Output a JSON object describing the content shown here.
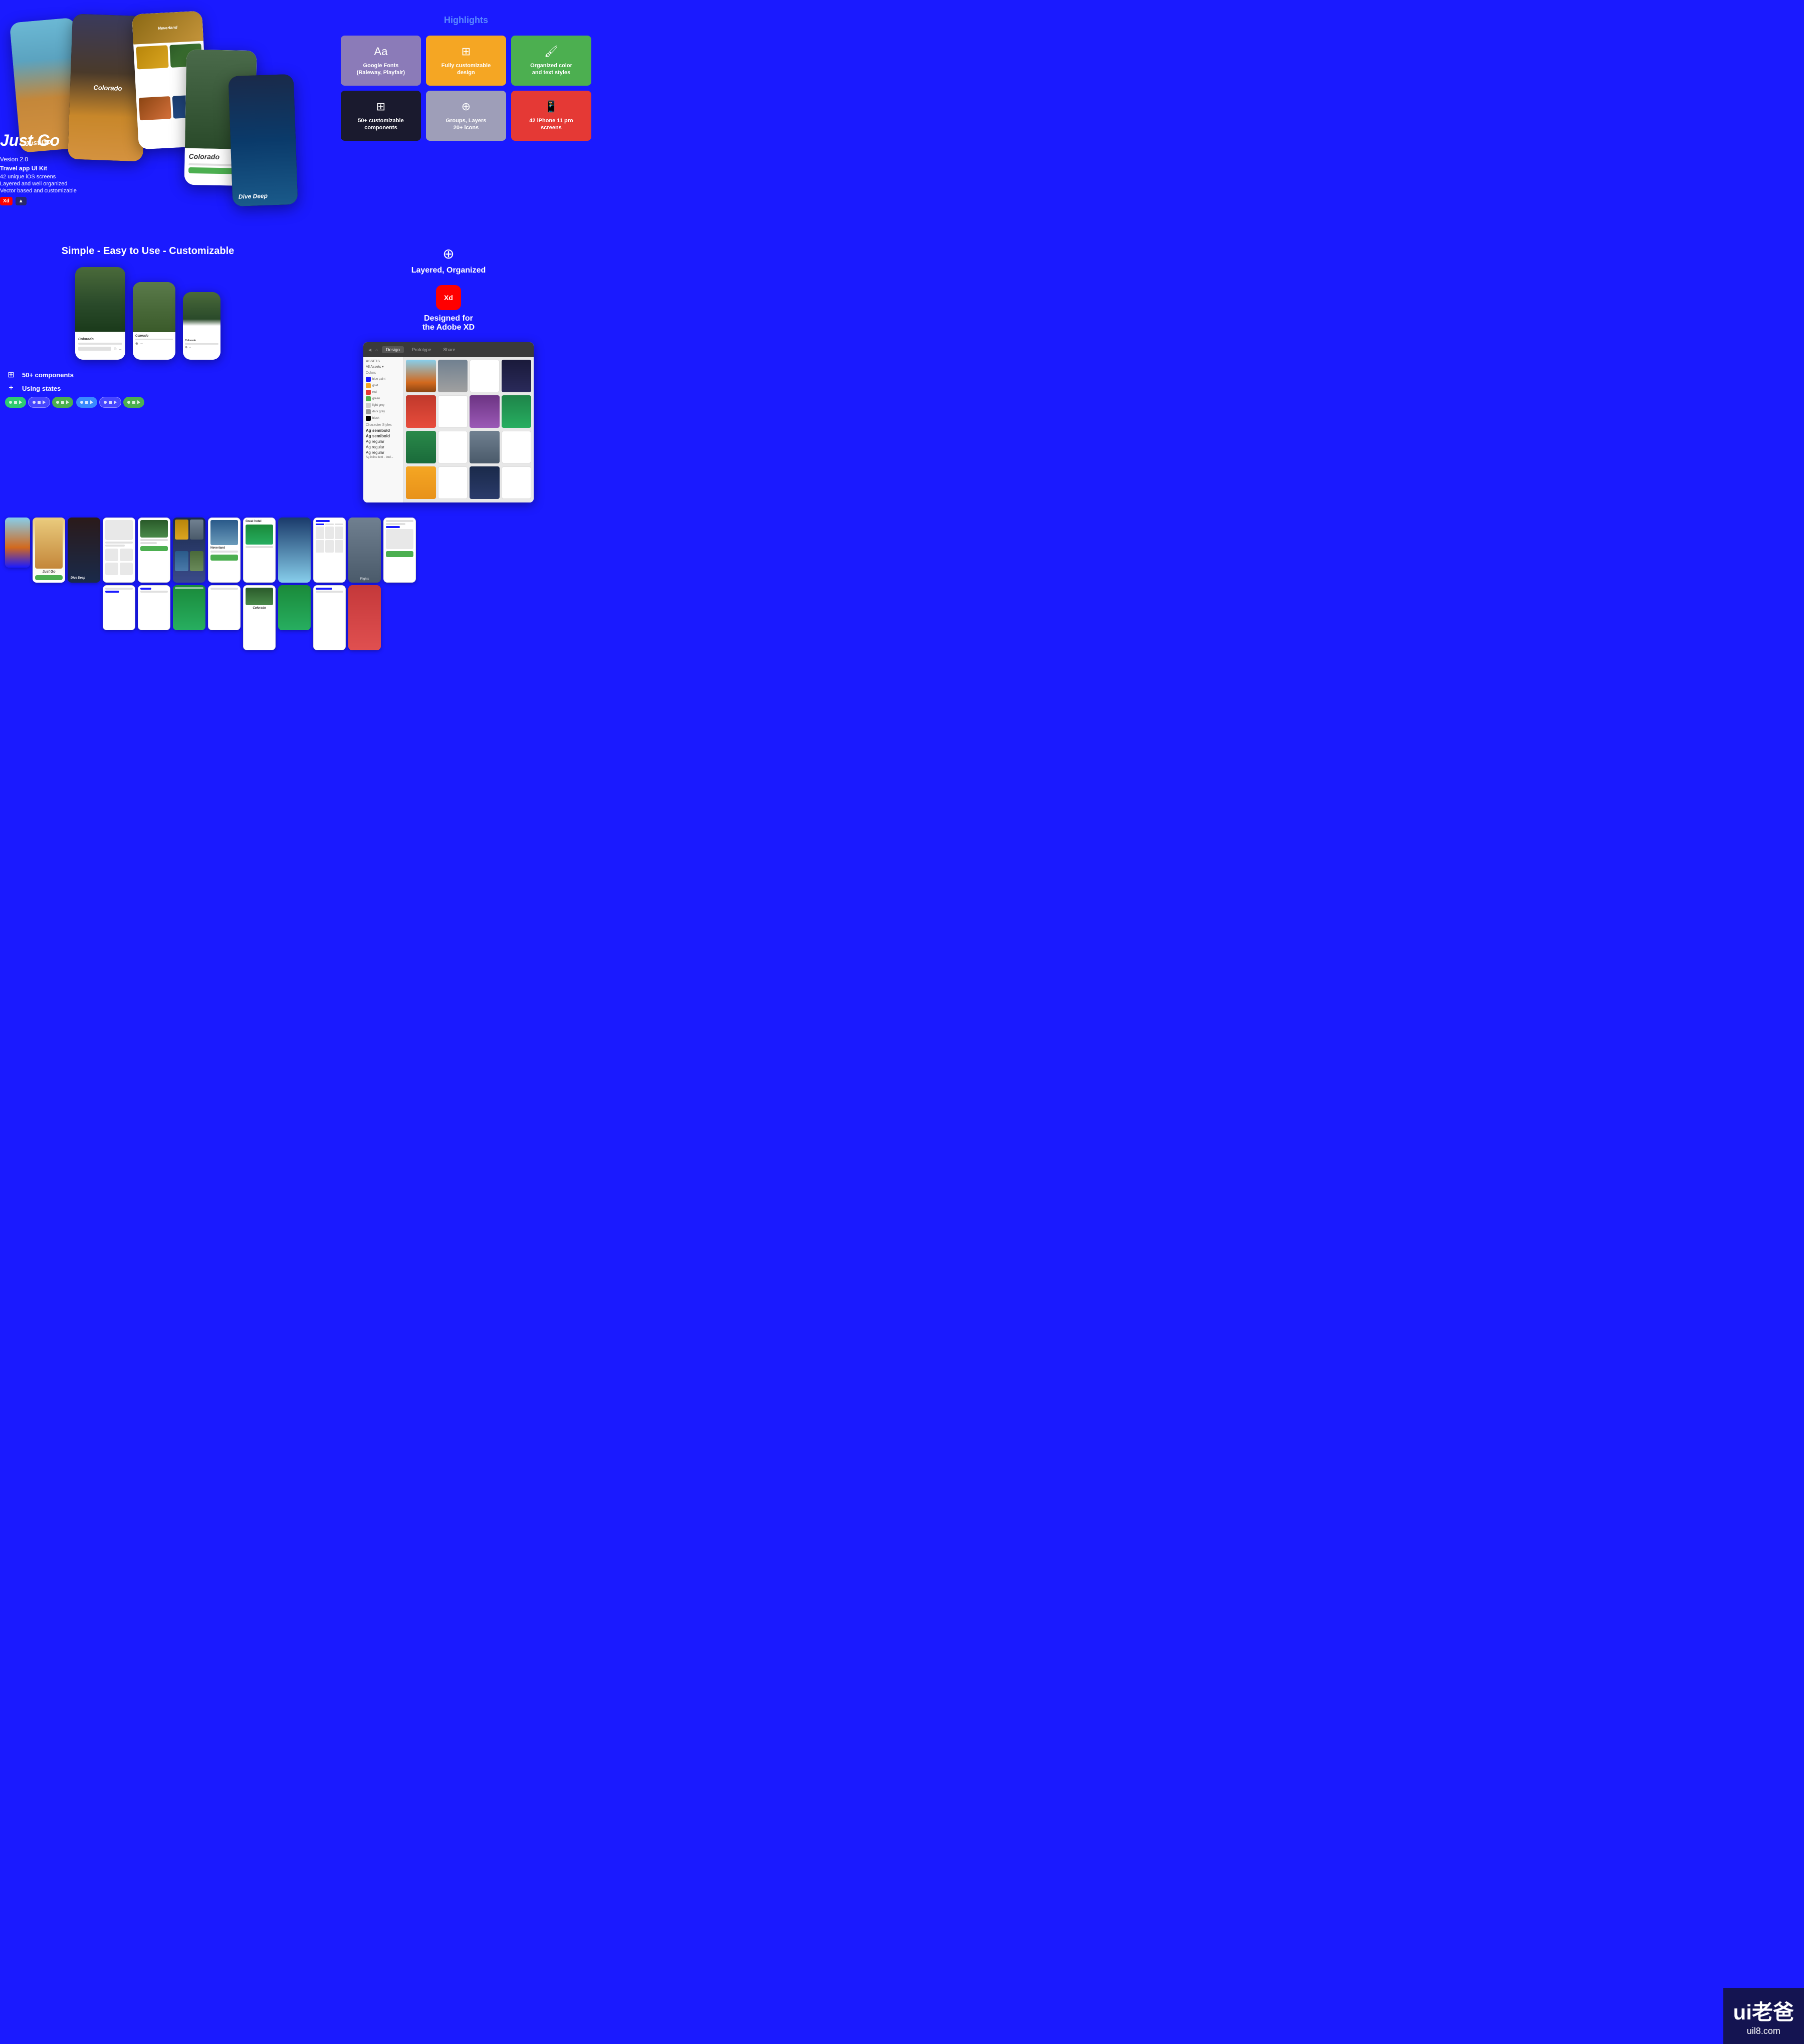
{
  "brand": {
    "title": "Just Go",
    "version": "Vesion 2.0",
    "kit": "Travel app UI Kit",
    "features": [
      "42 unique iOS screens",
      "Layered and well organized",
      "Vector based and customizable"
    ],
    "badges": [
      "XD",
      "Figma"
    ]
  },
  "highlights": {
    "section_title": "Highlights",
    "cards": [
      {
        "id": "google-fonts",
        "color": "purple",
        "icon": "Aa",
        "label": "Google Fonts\n(Raleway, Playfair)",
        "label1": "Google Fonts",
        "label2": "(Raleway, Playfair)"
      },
      {
        "id": "customizable-design",
        "color": "yellow",
        "icon": "⊞",
        "label": "Fully customizable\ndesign",
        "label1": "Fully customizable",
        "label2": "design"
      },
      {
        "id": "color-text-styles",
        "color": "green",
        "icon": "🎨",
        "label": "Organized color\nand text styles",
        "label1": "Organized color",
        "label2": "and text styles"
      },
      {
        "id": "customizable-components",
        "color": "dark",
        "icon": "⊞",
        "label": "50+ customizable\ncomponents",
        "label1": "50+ customizable",
        "label2": "components"
      },
      {
        "id": "groups-layers",
        "color": "gray",
        "icon": "⊕",
        "label": "Groups, Layers\n20+ icons",
        "label1": "Groups, Layers",
        "label2": "20+ icons"
      },
      {
        "id": "iphone-screens",
        "color": "red",
        "icon": "📱",
        "label": "42 iPhone 11 pro\nscreens",
        "label1": "42 iPhone 11 pro",
        "label2": "screens"
      }
    ]
  },
  "middle": {
    "tagline": "Simple - Easy to Use - Customizable",
    "components_label": "50+ components",
    "states_label": "Using states",
    "layered_label": "Layered, Organized",
    "xd_label": "Designed for\nthe Adobe XD",
    "xd_label1": "Designed for",
    "xd_label2": "the Adobe XD"
  },
  "adobe_panel": {
    "tabs": [
      "Design",
      "Prototype",
      "Share"
    ],
    "active_tab": "Design",
    "assets_label": "ASSETS",
    "all_assets": "All Assets",
    "colors_label": "Colors",
    "color_swatches": [
      {
        "color": "#1a1aff",
        "name": "blue paint"
      },
      {
        "color": "#f5a623",
        "name": "gold"
      },
      {
        "color": "#e53935",
        "name": "red"
      },
      {
        "color": "#4caf50",
        "name": "green"
      },
      {
        "color": "#cccccc",
        "name": "light grey"
      },
      {
        "color": "#999999",
        "name": "dark grey"
      },
      {
        "color": "#000000",
        "name": "black"
      }
    ],
    "fonts_label": "Character Styles",
    "font_styles": [
      {
        "name": "Ag",
        "weight": "semibold"
      },
      {
        "name": "Ag",
        "weight": "semibold"
      },
      {
        "name": "Ag",
        "weight": "regular"
      },
      {
        "name": "Ag",
        "weight": "regular"
      },
      {
        "name": "Ag",
        "weight": "regular"
      },
      {
        "name": "Ag",
        "weight": "small"
      }
    ]
  },
  "watermark": {
    "main": "ui老爸",
    "sub": "uil8.com"
  }
}
